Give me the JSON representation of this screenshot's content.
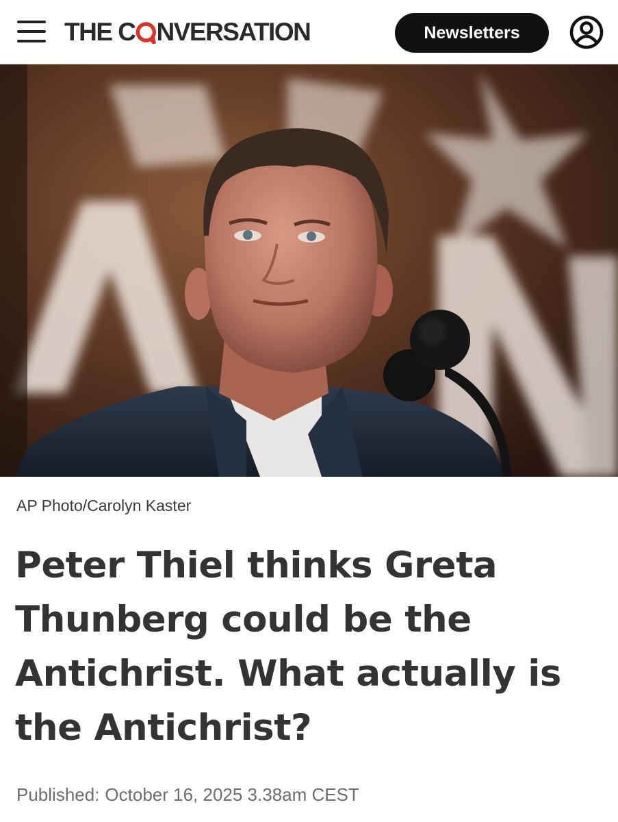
{
  "header": {
    "brand_prefix": "THE C",
    "brand_suffix": "NVERSATION",
    "newsletters_label": "Newsletters"
  },
  "article": {
    "photo_credit": "AP Photo/Carolyn Kaster",
    "headline": "Peter Thiel thinks Greta Thunberg could be the Antichrist. What actually is the Antichrist?",
    "published_label": "Published:",
    "published_date": "October 16, 2025 3.38am CEST"
  },
  "colors": {
    "brand_accent": "#d8352a",
    "button_bg": "#111111",
    "headline_text": "#333333"
  },
  "icons": {
    "menu": "hamburger-icon",
    "account": "user-account-icon"
  }
}
